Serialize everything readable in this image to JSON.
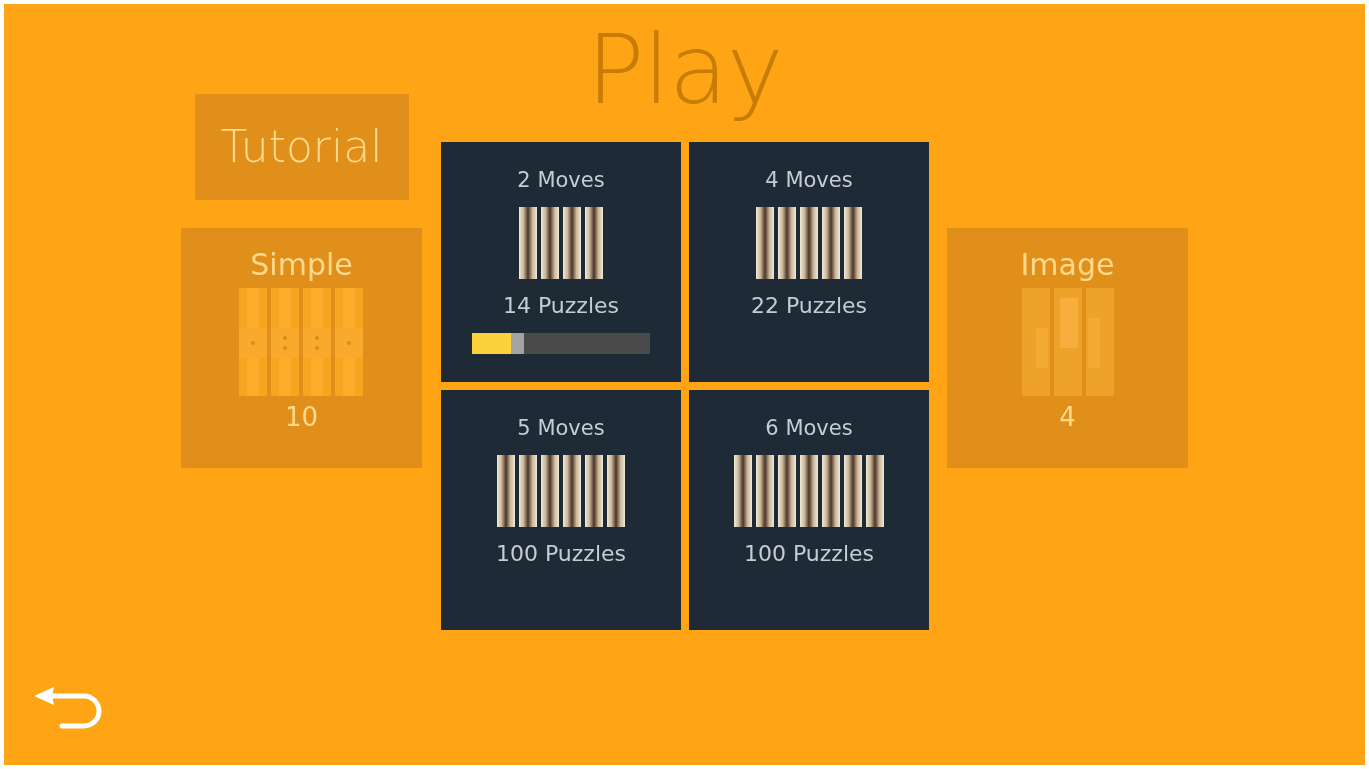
{
  "title": "Play",
  "menu": {
    "tutorial": "Tutorial",
    "modes": [
      {
        "kind": "simple",
        "label": "Simple",
        "count": "10"
      },
      {
        "kind": "image",
        "label": "Image",
        "count": "4"
      }
    ]
  },
  "levels": [
    {
      "moves": "2 Moves",
      "puzzles": "14 Puzzles",
      "progress": {
        "level": 0.22
      }
    },
    {
      "moves": "4 Moves",
      "puzzles": "22 Puzzles"
    },
    {
      "moves": "5 Moves",
      "puzzles": "100 Puzzles"
    },
    {
      "moves": "6 Moves",
      "puzzles": "100 Puzzles"
    }
  ]
}
